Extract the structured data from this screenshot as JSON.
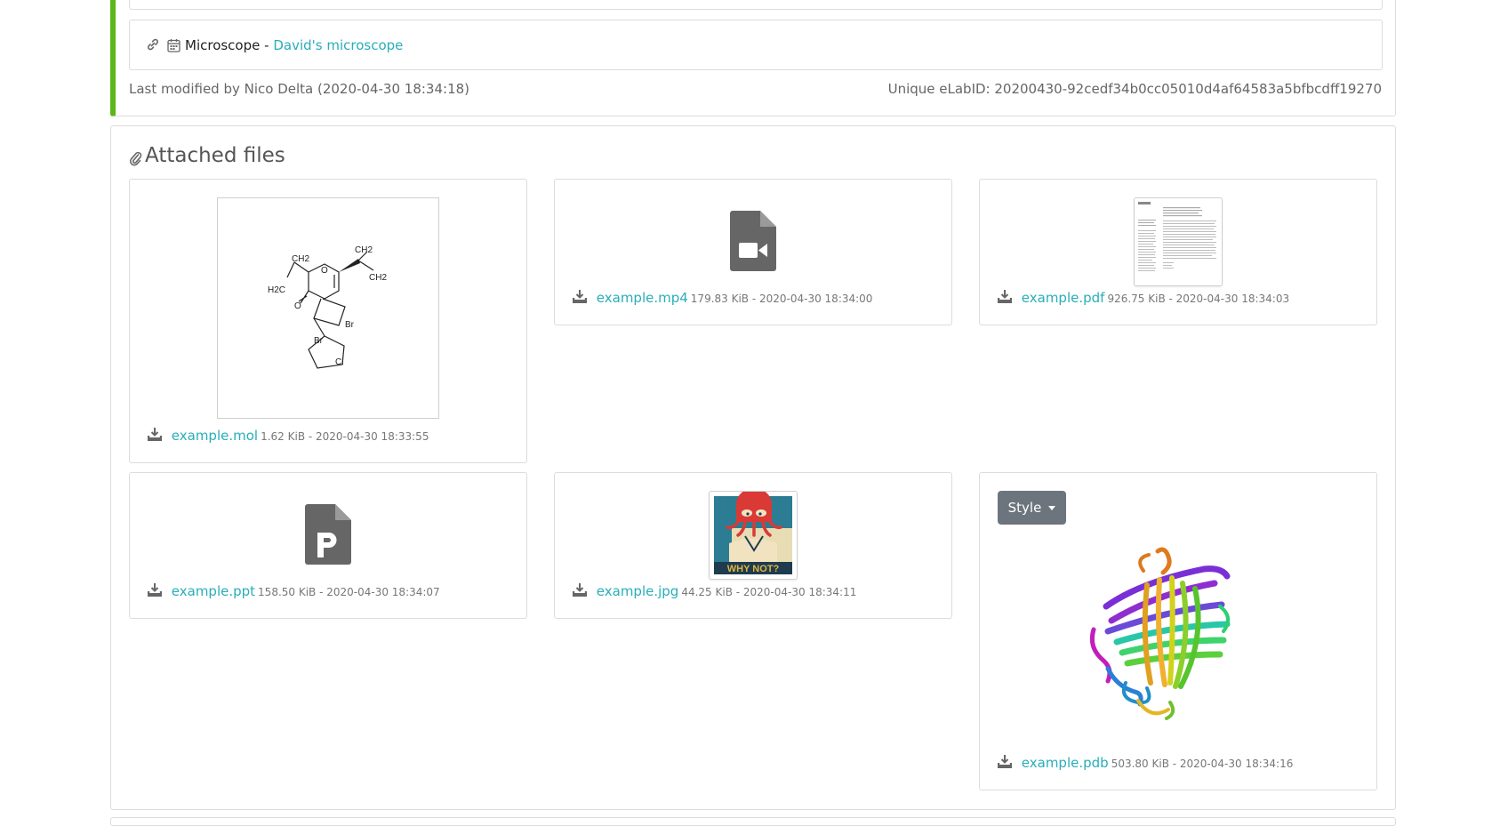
{
  "item": {
    "link_type": "Microscope",
    "separator": " - ",
    "link_title": "David's microscope",
    "last_modified": "Last modified by Nico Delta (2020-04-30 18:34:18)",
    "unique_id": "Unique eLabID: 20200430-92cedf34b0cc05010d4af64583a5bfbcdff19270"
  },
  "attachments": {
    "title": "Attached files",
    "files": [
      {
        "name": "example.mol",
        "info": "1.62 KiB - 2020-04-30 18:33:55"
      },
      {
        "name": "example.mp4",
        "info": "179.83 KiB - 2020-04-30 18:34:00"
      },
      {
        "name": "example.pdf",
        "info": "926.75 KiB - 2020-04-30 18:34:03"
      },
      {
        "name": "example.ppt",
        "info": "158.50 KiB - 2020-04-30 18:34:07"
      },
      {
        "name": "example.jpg",
        "info": "44.25 KiB - 2020-04-30 18:34:11"
      },
      {
        "name": "example.pdb",
        "info": "503.80 KiB - 2020-04-30 18:34:16"
      }
    ],
    "style_button": "Style",
    "molecule_labels": [
      "CH2",
      "CH2",
      "CH2",
      "H2C",
      "O",
      "O",
      "Br",
      "Br",
      "Cl"
    ],
    "jpg_caption": "WHY NOT?"
  },
  "colors": {
    "accent_green": "#5bb71b",
    "link": "#29aeb9",
    "button_gray": "#6c757d"
  }
}
